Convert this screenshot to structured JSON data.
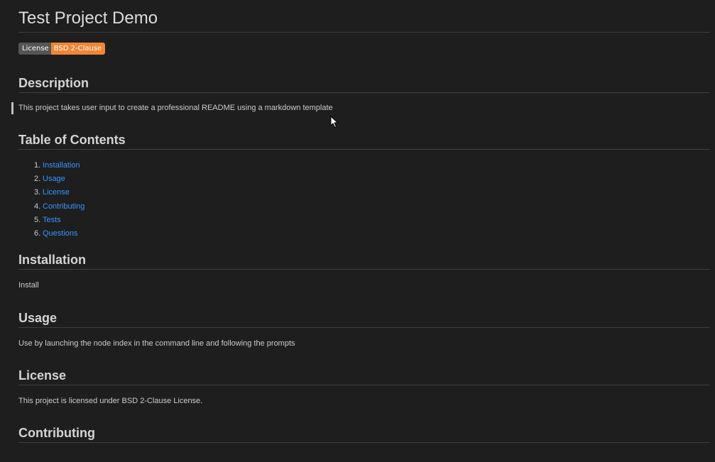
{
  "title": "Test Project Demo",
  "badge": {
    "left_label": "License",
    "right_label": "BSD 2-Clause",
    "right_color": "#f18634"
  },
  "sections": {
    "description": {
      "heading": "Description",
      "text": "This project takes user input to create a professional README using a markdown template"
    },
    "toc": {
      "heading": "Table of Contents",
      "items": [
        {
          "num": "1.",
          "label": "Installation"
        },
        {
          "num": "2.",
          "label": "Usage"
        },
        {
          "num": "3.",
          "label": "License"
        },
        {
          "num": "4.",
          "label": "Contributing"
        },
        {
          "num": "5.",
          "label": "Tests"
        },
        {
          "num": "6.",
          "label": "Questions"
        }
      ]
    },
    "installation": {
      "heading": "Installation",
      "text": "Install"
    },
    "usage": {
      "heading": "Usage",
      "text": "Use by launching the node index in the command line and following the prompts"
    },
    "license": {
      "heading": "License",
      "text": "This project is licensed under BSD 2-Clause License."
    },
    "contributing": {
      "heading": "Contributing"
    }
  },
  "colors": {
    "background": "#1e1e1e",
    "link": "#3794ff",
    "rule": "#3f3f3f"
  },
  "icons": {
    "cursor": "mouse-pointer-icon"
  }
}
